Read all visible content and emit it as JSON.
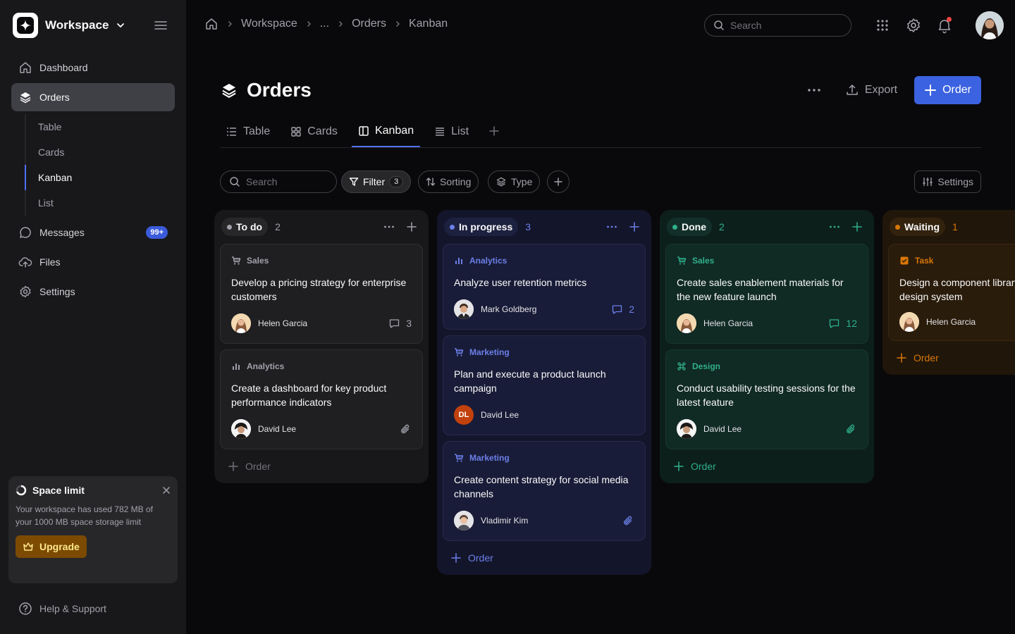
{
  "workspace": {
    "name": "Workspace"
  },
  "sidebar": {
    "nav": [
      {
        "label": "Dashboard",
        "icon": "home-icon"
      },
      {
        "label": "Orders",
        "icon": "layers-icon"
      },
      {
        "label": "Messages",
        "icon": "chat-icon",
        "badge": "99+"
      },
      {
        "label": "Files",
        "icon": "cloud-upload-icon"
      },
      {
        "label": "Settings",
        "icon": "gear-icon"
      }
    ],
    "orders_sub": [
      "Table",
      "Cards",
      "Kanban",
      "List"
    ],
    "space_limit": {
      "title": "Space limit",
      "text": "Your workspace has used 782 MB of your 1000 MB space storage limit",
      "upgrade": "Upgrade"
    },
    "help": "Help & Support"
  },
  "breadcrumb": [
    "Workspace",
    "...",
    "Orders",
    "Kanban"
  ],
  "top_search": {
    "placeholder": "Search"
  },
  "page": {
    "title": "Orders",
    "export_label": "Export",
    "order_label": "Order"
  },
  "tabs": [
    {
      "label": "Table",
      "icon": "list-icon"
    },
    {
      "label": "Cards",
      "icon": "grid-icon"
    },
    {
      "label": "Kanban",
      "icon": "kanban-icon"
    },
    {
      "label": "List",
      "icon": "list-lines-icon"
    }
  ],
  "filters": {
    "search_placeholder": "Search",
    "filter_label": "Filter",
    "filter_count": "3",
    "sorting_label": "Sorting",
    "type_label": "Type",
    "settings_label": "Settings"
  },
  "columns": [
    {
      "title": "To do",
      "count": "2",
      "accent": "#a1a1aa",
      "cards": [
        {
          "category": "Sales",
          "cat_icon": "cart-icon",
          "title": "Develop a pricing strategy for enterprise customers",
          "person": "Helen Garcia",
          "meta": "3",
          "meta_icon": "comment-icon"
        },
        {
          "category": "Analytics",
          "cat_icon": "bar-chart-icon",
          "title": "Create a dashboard for key product performance indicators",
          "person": "David Lee",
          "meta": "",
          "meta_icon": "paperclip-icon"
        }
      ],
      "add_label": "Order"
    },
    {
      "title": "In progress",
      "count": "3",
      "accent": "#6b7fe8",
      "cards": [
        {
          "category": "Analytics",
          "cat_icon": "bar-chart-icon",
          "title": "Analyze user retention metrics",
          "person": "Mark Goldberg",
          "meta": "2",
          "meta_icon": "comment-icon"
        },
        {
          "category": "Marketing",
          "cat_icon": "cart-icon",
          "title": "Plan and execute a product launch campaign",
          "person": "David Lee",
          "initials": "DL",
          "meta": "",
          "meta_icon": ""
        },
        {
          "category": "Marketing",
          "cat_icon": "cart-icon",
          "title": "Create content strategy for social media channels",
          "person": "Vladimir Kim",
          "meta": "",
          "meta_icon": "paperclip-icon"
        }
      ],
      "add_label": "Order"
    },
    {
      "title": "Done",
      "count": "2",
      "accent": "#2fb08a",
      "cards": [
        {
          "category": "Sales",
          "cat_icon": "cart-icon",
          "title": "Create sales enablement materials for the new feature launch",
          "person": "Helen Garcia",
          "meta": "12",
          "meta_icon": "comment-icon"
        },
        {
          "category": "Design",
          "cat_icon": "command-icon",
          "title": "Conduct usability testing sessions for the latest feature",
          "person": "David Lee",
          "meta": "",
          "meta_icon": "paperclip-icon"
        }
      ],
      "add_label": "Order"
    },
    {
      "title": "Waiting",
      "count": "1",
      "accent": "#d97706",
      "cards": [
        {
          "category": "Task",
          "cat_icon": "checkbox-icon",
          "title": "Design a component library for the design system",
          "person": "Helen Garcia",
          "meta": "",
          "meta_icon": ""
        }
      ],
      "add_label": "Order"
    }
  ]
}
